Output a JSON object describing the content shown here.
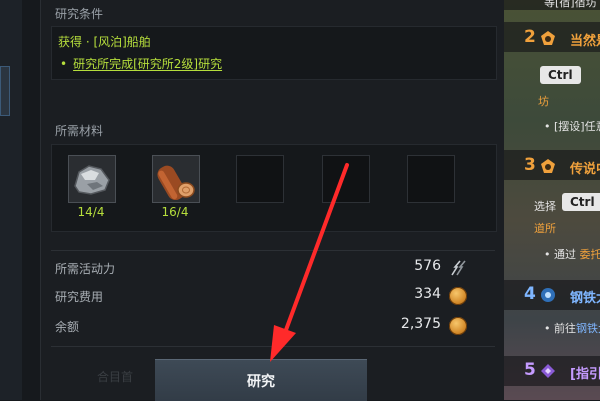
{
  "research": {
    "conditions_title": "研究条件",
    "conditions": [
      {
        "bullet": "•",
        "text": "获得 · [风泊]船舶"
      },
      {
        "bullet": "•",
        "text": "研究所完成[研究所2级]研究"
      }
    ],
    "materials_title": "所需材料",
    "materials": [
      {
        "name": "ore",
        "count": "14/4"
      },
      {
        "name": "timber",
        "count": "16/4"
      }
    ],
    "stats": [
      {
        "label": "所需活动力",
        "value": "576",
        "icon": "energy-icon"
      },
      {
        "label": "研究费用",
        "value": "334",
        "icon": "silver-coin-icon"
      },
      {
        "label": "余额",
        "value": "2,375",
        "icon": "silver-coin-icon"
      }
    ],
    "research_button": "研究",
    "ghost_text": "合目首"
  },
  "quests": {
    "top_partial": "等[宿]宿坊",
    "items": [
      {
        "num": "2",
        "title": "当然是",
        "sub1_key": "Ctrl",
        "sub2": "坊",
        "sub3": "• [摆设]任意"
      },
      {
        "num": "3",
        "title": "传说中",
        "sub1_prefix": "选择",
        "sub1_key": "Ctrl",
        "sub2": "道所",
        "sub3_prefix": "• 通过 ",
        "sub3_hl": "委托"
      },
      {
        "num": "4",
        "title": "钢铁大",
        "sub3_prefix": "• 前往",
        "sub3_hl": "钢铁大"
      },
      {
        "num": "5",
        "title": "[指引]",
        "sub3": ""
      }
    ]
  },
  "colors": {
    "accent_green": "#b6de3c",
    "quest_orange": "#f0a13c",
    "annotation_red": "#ff2a2a"
  }
}
